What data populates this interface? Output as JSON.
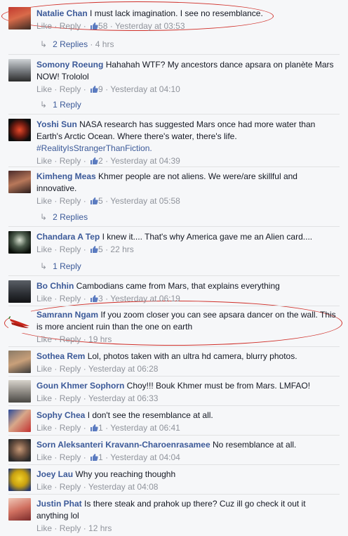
{
  "dot": " · ",
  "comments": [
    {
      "name": "Natalie Chan",
      "text": "I must lack imagination. I see no resemblance.",
      "like": "Like",
      "reply": "Reply",
      "likes": "58",
      "time": "Yesterday at 03:53"
    },
    {
      "name": "Somony Roeung",
      "text": "Hahahah WTF? My ancestors dance apsara on planète Mars NOW! Trololol",
      "like": "Like",
      "reply": "Reply",
      "likes": "9",
      "time": "Yesterday at 04:10"
    },
    {
      "name": "Yoshi Sun",
      "text": "NASA research has suggested Mars once had more water than Earth's Arctic Ocean. Where there's water, there's life.",
      "hashtag": "#RealityIsStrangerThanFiction.",
      "like": "Like",
      "reply": "Reply",
      "likes": "2",
      "time": "Yesterday at 04:39"
    },
    {
      "name": "Kimheng Meas",
      "text": "Khmer people are not aliens. We were/are skillful and innovative.",
      "like": "Like",
      "reply": "Reply",
      "likes": "5",
      "time": "Yesterday at 05:58"
    },
    {
      "name": "Chandara A Tep",
      "text": "I knew it.... That's why America gave me an Alien card....",
      "like": "Like",
      "reply": "Reply",
      "likes": "5",
      "time": "22 hrs"
    },
    {
      "name": "Bo Chhin",
      "text": "Cambodians came from Mars, that explains everything",
      "like": "Like",
      "reply": "Reply",
      "likes": "3",
      "time": "Yesterday at 06:19"
    },
    {
      "name": "Samrann Ngam",
      "text": "If you zoom closer you can see apsara dancer on the wall. This is more ancient ruin than the one on earth",
      "like": "Like",
      "reply": "Reply",
      "time": "19 hrs"
    },
    {
      "name": "Sothea Rem",
      "text": "Lol, photos taken with an ultra hd camera, blurry photos.",
      "like": "Like",
      "reply": "Reply",
      "time": "Yesterday at 06:28"
    },
    {
      "name": "Goun Khmer Sophorn",
      "text": "Choy!!! Bouk Khmer must be from Mars. LMFAO!",
      "like": "Like",
      "reply": "Reply",
      "time": "Yesterday at 06:33"
    },
    {
      "name": "Sophy Chea",
      "text": "I don't see the resemblance at all.",
      "like": "Like",
      "reply": "Reply",
      "likes": "1",
      "time": "Yesterday at 06:41"
    },
    {
      "name": "Sorn Aleksanteri Kravann-Charoenrasamee",
      "text": "No resemblance at all.",
      "like": "Like",
      "reply": "Reply",
      "likes": "1",
      "time": "Yesterday at 04:04"
    },
    {
      "name": "Joey Lau",
      "text": "Why you reaching thoughh",
      "like": "Like",
      "reply": "Reply",
      "time": "Yesterday at 04:08"
    },
    {
      "name": "Justin Phat",
      "text": "Is there steak and prahok up there? Cuz ill go check it out it anything lol",
      "like": "Like",
      "reply": "Reply",
      "time": "12 hrs"
    }
  ],
  "reply_links": [
    {
      "label": "2 Replies",
      "time": "4 hrs"
    },
    {
      "label": "1 Reply"
    },
    {
      "label": "2 Replies"
    },
    {
      "label": "1 Reply"
    }
  ],
  "colors": {
    "name": "#3b5998",
    "meta": "#90949c",
    "annotation": "#d0302a"
  }
}
